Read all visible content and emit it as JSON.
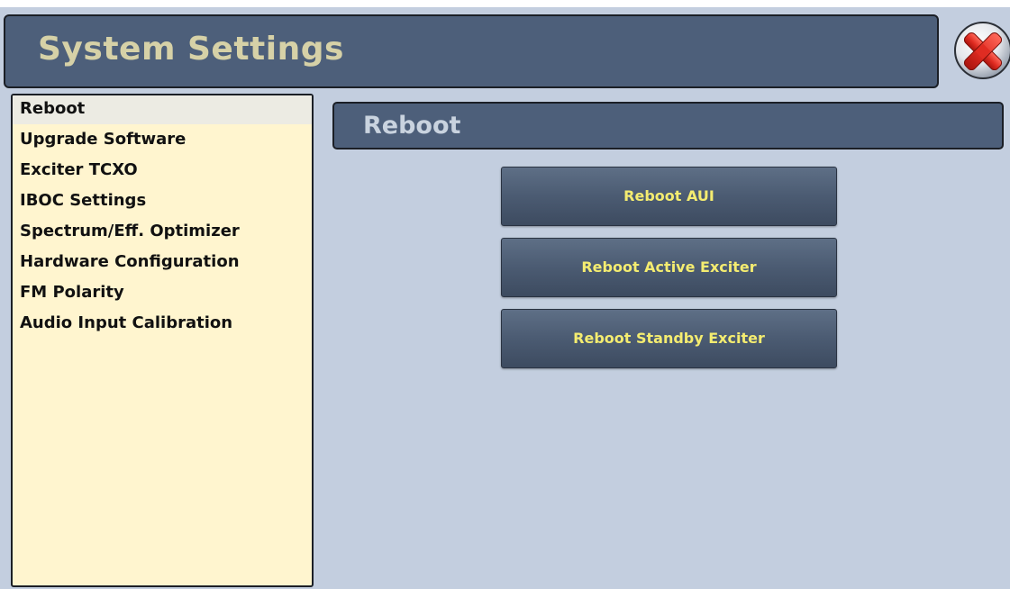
{
  "header": {
    "title": "System Settings",
    "close_icon": "close-icon"
  },
  "sidebar": {
    "items": [
      {
        "label": "Reboot",
        "selected": true
      },
      {
        "label": "Upgrade Software",
        "selected": false
      },
      {
        "label": "Exciter TCXO",
        "selected": false
      },
      {
        "label": "IBOC Settings",
        "selected": false
      },
      {
        "label": "Spectrum/Eff. Optimizer",
        "selected": false
      },
      {
        "label": "Hardware Configuration",
        "selected": false
      },
      {
        "label": "FM Polarity",
        "selected": false
      },
      {
        "label": "Audio Input Calibration",
        "selected": false
      }
    ]
  },
  "panel": {
    "title": "Reboot",
    "buttons": [
      {
        "label": "Reboot AUI"
      },
      {
        "label": "Reboot Active Exciter"
      },
      {
        "label": "Reboot Standby Exciter"
      }
    ]
  },
  "colors": {
    "background": "#c3cedf",
    "header_bg": "#4d5f7a",
    "title_text": "#d6d1a7",
    "sidebar_bg": "#fff5cf",
    "selected_bg": "#ecebe3",
    "button_text": "#f4ec70",
    "close_red": "#d93030"
  }
}
